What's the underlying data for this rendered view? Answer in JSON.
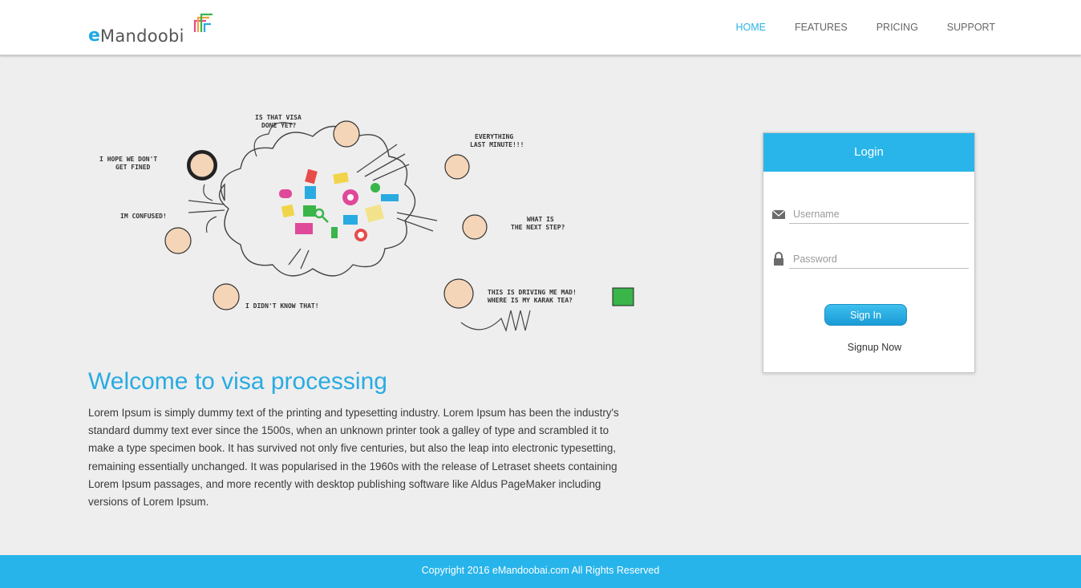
{
  "brand": {
    "logo_e": "e",
    "logo_rest": "Mandoobi"
  },
  "nav": {
    "home": "HOME",
    "features": "FEATURES",
    "pricing": "PRICING",
    "support": "SUPPORT"
  },
  "illustration": {
    "bubbles": {
      "visa": [
        "IS THAT VISA",
        "DONE YET?"
      ],
      "fined": [
        "I HOPE WE DON'T",
        "GET FINED"
      ],
      "minute": [
        "EVERYTHING",
        "LAST MINUTE!!!"
      ],
      "confused": [
        "IM CONFUSED!"
      ],
      "next": [
        "WHAT IS",
        "THE NEXT STEP?"
      ],
      "mad": [
        "THIS IS DRIVING ME MAD!",
        "WHERE IS MY KARAK TEA?"
      ],
      "know": [
        "I DIDN'T KNOW THAT!"
      ]
    }
  },
  "welcome": {
    "title": "Welcome to visa processing",
    "body": "Lorem Ipsum is simply dummy text of the printing and typesetting industry. Lorem Ipsum has been the industry's standard dummy text ever since the 1500s, when an unknown printer took a galley of type and scrambled it to make a type specimen book. It has survived not only five centuries, but also the leap into electronic typesetting, remaining essentially unchanged. It was popularised in the 1960s with the release of Letraset sheets containing Lorem Ipsum passages, and more recently with desktop publishing software like Aldus PageMaker including versions of Lorem Ipsum."
  },
  "login": {
    "title": "Login",
    "username_placeholder": "Username",
    "password_placeholder": "Password",
    "signin_label": "Sign In",
    "signup_label": "Signup Now"
  },
  "footer": {
    "copyright": "Copyright 2016 eMandoobai.com All Rights Reserved"
  },
  "colors": {
    "accent": "#29b5ea",
    "page_bg": "#eeeeee",
    "footer_bg": "#27b4ea"
  }
}
